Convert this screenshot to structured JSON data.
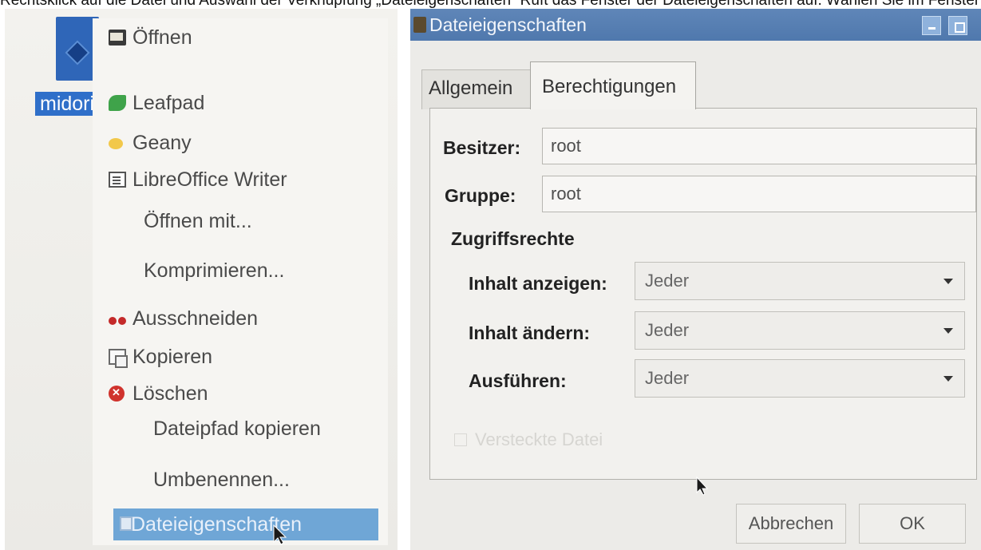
{
  "caption": "Rechtsklick auf die Datei und Auswahl der Verknüpfung „Dateieigenschaften“ Ruft das Fenster der Dateieigenschaften auf. Wählen Sie im Fenster den Reiter Berechtigungen und dann unter Zugriffsrechte",
  "desktop_icon": {
    "label": "midori",
    "icon": "midori-globe-icon"
  },
  "context_menu": {
    "items": [
      {
        "label": "Öffnen",
        "icon": "folder-icon"
      },
      {
        "label": "Leafpad",
        "icon": "leafpad-icon"
      },
      {
        "label": "Geany",
        "icon": "geany-icon"
      },
      {
        "label": "LibreOffice Writer",
        "icon": "writer-doc-icon"
      },
      {
        "label": "Öffnen mit..."
      },
      {
        "label": "Komprimieren..."
      },
      {
        "label": "Ausschneiden",
        "icon": "scissors-icon"
      },
      {
        "label": "Kopieren",
        "icon": "copy-icon"
      },
      {
        "label": "Löschen",
        "icon": "delete-icon"
      },
      {
        "label": "Dateipfad kopieren"
      },
      {
        "label": "Umbenennen..."
      },
      {
        "label": "Dateieigenschaften",
        "icon": "properties-icon",
        "selected": true
      }
    ]
  },
  "dialog": {
    "title": "Dateieigenschaften",
    "tabs": [
      "Allgemein",
      "Berechtigungen"
    ],
    "active_tab": "Berechtigungen",
    "owner_label": "Besitzer:",
    "owner_value": "root",
    "group_label": "Gruppe:",
    "group_value": "root",
    "access_heading": "Zugriffsrechte",
    "permissions": [
      {
        "label": "Inhalt anzeigen:",
        "value": "Jeder"
      },
      {
        "label": "Inhalt ändern:",
        "value": "Jeder"
      },
      {
        "label": "Ausführen:",
        "value": "Jeder"
      }
    ],
    "hidden_files_label": "Versteckte Datei",
    "cancel_label": "Abbrechen",
    "ok_label": "OK"
  },
  "colors": {
    "titlebar": "#5479af",
    "selection": "#6fa6d6",
    "desktop_label_bg": "#2f6fc9"
  }
}
